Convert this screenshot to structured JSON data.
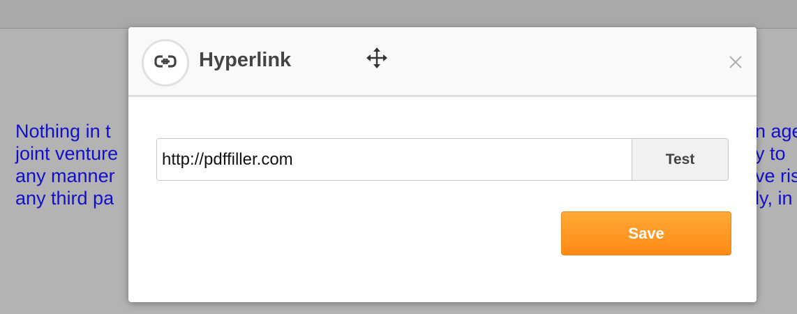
{
  "background": {
    "left_lines": [
      "Nothing in t",
      "joint venture",
      "any manner",
      "any third pa"
    ],
    "right_lines": [
      "n age",
      "y to",
      "ve ris",
      "ly, in"
    ]
  },
  "dialog": {
    "title": "Hyperlink",
    "header_icon": "link-icon",
    "move_icon": "move-icon",
    "close_icon": "close-icon",
    "url_value": "http://pdffiller.com",
    "test_label": "Test",
    "save_label": "Save"
  },
  "colors": {
    "background_text": "#1010c8",
    "save_button": "#fe8a15",
    "title_text": "#444444"
  }
}
